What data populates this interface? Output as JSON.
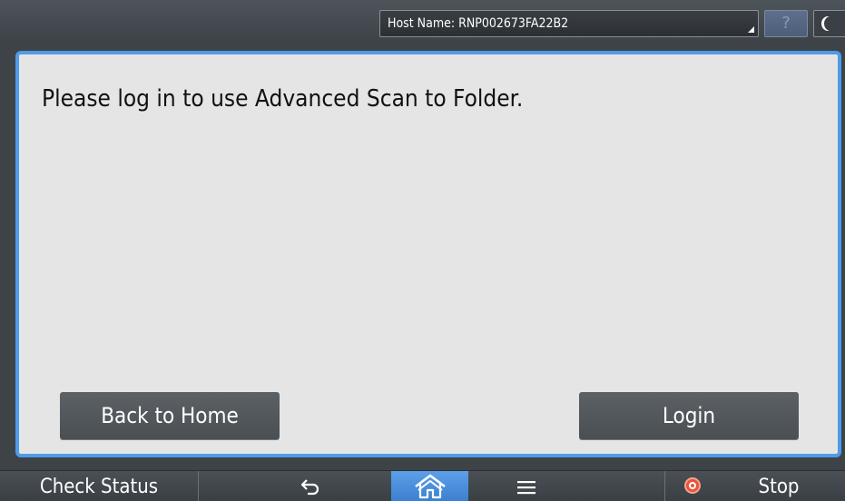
{
  "topbar": {
    "host_name_label": "Host Name: RNP002673FA22B2",
    "help_label": "?"
  },
  "dialog": {
    "message": "Please log in to use Advanced Scan to Folder.",
    "back_home_label": "Back to Home",
    "login_label": "Login"
  },
  "bottombar": {
    "check_status_label": "Check Status",
    "stop_label": "Stop",
    "icons": {
      "back": "undo-arrow-icon",
      "home": "home-icon",
      "menu": "menu-icon",
      "stop": "stop-icon"
    }
  },
  "colors": {
    "dialog_border": "#4f9be8",
    "home_active": "#4a8edc",
    "stop_red": "#e8543a"
  }
}
